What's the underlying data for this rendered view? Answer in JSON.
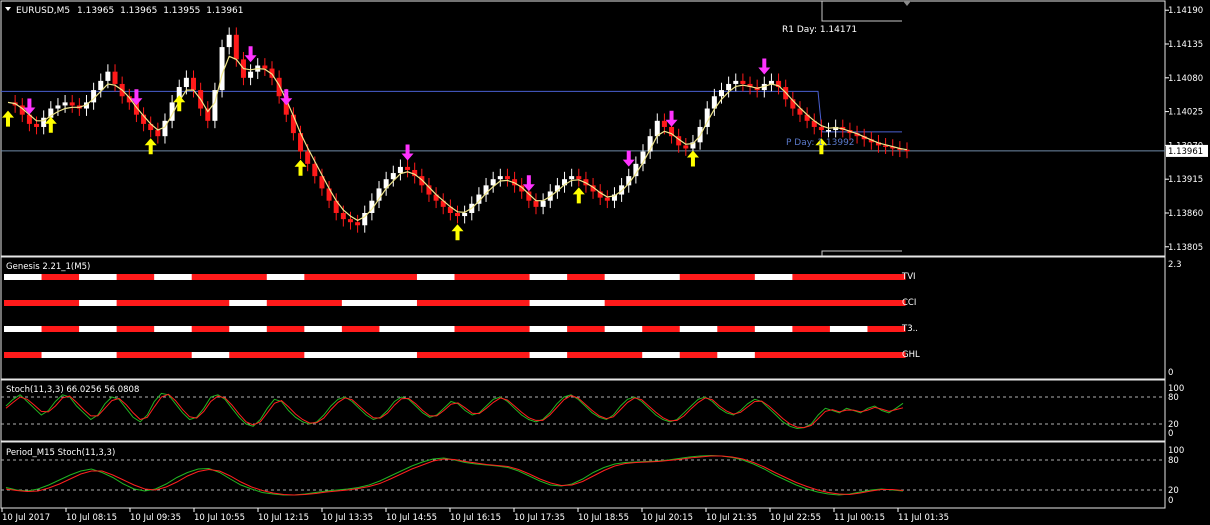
{
  "chart_data": {
    "type": "candlestick",
    "main": {
      "title": "EURUSD,M5",
      "ohlc": [
        "1.13965",
        "1.13965",
        "1.13955",
        "1.13961"
      ],
      "ylim": [
        1.1379,
        1.14205
      ],
      "y_ticks": [
        "1.14190",
        "1.14135",
        "1.14080",
        "1.14025",
        "1.13970",
        "1.13915",
        "1.13860",
        "1.13805"
      ],
      "current_price": "1.13961",
      "r1_label": "R1 Day: 1.14171",
      "pivot_label": "P Day: 1.13992",
      "pivot_level": 1.13992,
      "old_level": 1.14058,
      "close_series": [
        1.1404,
        1.14035,
        1.1402,
        1.14005,
        1.14,
        1.14015,
        1.1403,
        1.14035,
        1.1404,
        1.14035,
        1.1403,
        1.1404,
        1.1406,
        1.14075,
        1.1409,
        1.1407,
        1.1405,
        1.1404,
        1.1402,
        1.14005,
        1.13995,
        1.13985,
        1.1401,
        1.1404,
        1.14065,
        1.1408,
        1.1406,
        1.1403,
        1.1401,
        1.1406,
        1.1413,
        1.1415,
        1.1411,
        1.1408,
        1.1409,
        1.141,
        1.14095,
        1.1408,
        1.1405,
        1.1402,
        1.1399,
        1.1396,
        1.1394,
        1.1392,
        1.139,
        1.1388,
        1.1386,
        1.1385,
        1.13845,
        1.1384,
        1.1386,
        1.1388,
        1.139,
        1.13915,
        1.13925,
        1.13935,
        1.1393,
        1.1392,
        1.13905,
        1.1389,
        1.1388,
        1.1387,
        1.1386,
        1.13855,
        1.1386,
        1.13875,
        1.1389,
        1.13905,
        1.13915,
        1.1392,
        1.13915,
        1.13905,
        1.13895,
        1.1388,
        1.1387,
        1.1388,
        1.13895,
        1.13905,
        1.13915,
        1.1392,
        1.13915,
        1.13905,
        1.13895,
        1.13885,
        1.1388,
        1.1389,
        1.13905,
        1.1392,
        1.1394,
        1.1396,
        1.13985,
        1.1401,
        1.14,
        1.13985,
        1.1397,
        1.13965,
        1.13975,
        1.14,
        1.1403,
        1.1405,
        1.1406,
        1.1407,
        1.14075,
        1.1407,
        1.14065,
        1.1406,
        1.1407,
        1.14075,
        1.14065,
        1.14045,
        1.1403,
        1.1402,
        1.1401,
        1.14,
        1.13995,
        1.13995,
        1.14,
        1.13995,
        1.1399,
        1.13985,
        1.1398,
        1.13975,
        1.1397,
        1.13968,
        1.13965,
        1.13963,
        1.13961
      ],
      "ma_series": [
        1.1404,
        1.14038,
        1.1403,
        1.1402,
        1.1401,
        1.1401,
        1.14018,
        1.14025,
        1.1403,
        1.14032,
        1.14032,
        1.14036,
        1.14046,
        1.14058,
        1.1407,
        1.14068,
        1.1406,
        1.14048,
        1.14032,
        1.14018,
        1.14005,
        1.13995,
        1.14,
        1.1402,
        1.14042,
        1.1406,
        1.1406,
        1.14045,
        1.14025,
        1.1404,
        1.14085,
        1.14115,
        1.1411,
        1.14095,
        1.14093,
        1.14095,
        1.14094,
        1.14086,
        1.14068,
        1.14044,
        1.14018,
        1.1399,
        1.13966,
        1.13944,
        1.13922,
        1.139,
        1.1388,
        1.13865,
        1.13855,
        1.13848,
        1.13854,
        1.13866,
        1.13883,
        1.139,
        1.13912,
        1.13924,
        1.13927,
        1.13923,
        1.13914,
        1.13902,
        1.1389,
        1.1388,
        1.1387,
        1.13862,
        1.13861,
        1.13868,
        1.13879,
        1.13892,
        1.13903,
        1.13912,
        1.13913,
        1.13909,
        1.13902,
        1.13891,
        1.1388,
        1.1388,
        1.13887,
        1.13896,
        1.13906,
        1.13913,
        1.13914,
        1.13909,
        1.13902,
        1.13893,
        1.13886,
        1.13888,
        1.13896,
        1.13908,
        1.13924,
        1.13942,
        1.13963,
        1.13986,
        1.13993,
        1.13989,
        1.1398,
        1.13972,
        1.13973,
        1.13986,
        1.14008,
        1.14029,
        1.14045,
        1.14057,
        1.14066,
        1.14068,
        1.14066,
        1.14063,
        1.14066,
        1.1407,
        1.14067,
        1.14056,
        1.14043,
        1.14031,
        1.1402,
        1.1401,
        1.14002,
        1.13998,
        1.13999,
        1.13997,
        1.13993,
        1.13989,
        1.13984,
        1.13979,
        1.13974,
        1.13971,
        1.13968,
        1.13965,
        1.13963
      ],
      "arrows_up": [
        0,
        6,
        20,
        24,
        41,
        63,
        80,
        96,
        114
      ],
      "arrows_down": [
        3,
        18,
        34,
        39,
        56,
        73,
        87,
        93,
        106
      ]
    },
    "x_ticks": [
      "10 Jul 2017",
      "10 Jul 08:15",
      "10 Jul 09:35",
      "10 Jul 10:55",
      "10 Jul 12:15",
      "10 Jul 13:35",
      "10 Jul 14:55",
      "10 Jul 16:15",
      "10 Jul 17:35",
      "10 Jul 18:55",
      "10 Jul 20:15",
      "10 Jul 21:35",
      "10 Jul 22:55",
      "11 Jul 00:15",
      "11 Jul 01:35"
    ],
    "genesis": {
      "title": "Genesis 2.21_1(M5)",
      "y_ticks": [
        "2.3",
        "0"
      ],
      "rows": [
        {
          "name": "TVI",
          "segments": [
            "w",
            "r",
            "w",
            "r",
            "w",
            "r",
            "r",
            "w",
            "r",
            "r",
            "r",
            "w",
            "r",
            "r",
            "w",
            "r",
            "w",
            "w",
            "r",
            "r",
            "w",
            "r",
            "r",
            "r"
          ]
        },
        {
          "name": "CCI",
          "segments": [
            "r",
            "r",
            "w",
            "r",
            "r",
            "r",
            "w",
            "r",
            "r",
            "w",
            "w",
            "r",
            "r",
            "r",
            "w",
            "w",
            "r",
            "r",
            "r",
            "r",
            "r",
            "r",
            "r",
            "r"
          ]
        },
        {
          "name": "T3..",
          "segments": [
            "w",
            "r",
            "w",
            "r",
            "w",
            "r",
            "w",
            "r",
            "w",
            "r",
            "w",
            "w",
            "r",
            "r",
            "w",
            "r",
            "w",
            "r",
            "w",
            "r",
            "w",
            "r",
            "w",
            "r"
          ]
        },
        {
          "name": "GHL",
          "segments": [
            "r",
            "w",
            "w",
            "r",
            "r",
            "w",
            "r",
            "r",
            "w",
            "w",
            "w",
            "r",
            "r",
            "r",
            "w",
            "r",
            "r",
            "w",
            "r",
            "w",
            "r",
            "r",
            "r",
            "r"
          ]
        }
      ]
    },
    "stoch1": {
      "title": "Stoch(11,3,3) 66.0256 56.0808",
      "y_ticks": [
        "100",
        "80",
        "20",
        "0"
      ],
      "main": [
        60,
        75,
        85,
        70,
        55,
        40,
        50,
        70,
        85,
        80,
        60,
        45,
        30,
        40,
        65,
        80,
        75,
        55,
        35,
        25,
        40,
        70,
        88,
        85,
        65,
        45,
        30,
        35,
        55,
        80,
        85,
        75,
        55,
        35,
        20,
        15,
        30,
        55,
        75,
        70,
        50,
        35,
        25,
        20,
        25,
        40,
        60,
        75,
        80,
        70,
        55,
        40,
        30,
        35,
        50,
        70,
        80,
        75,
        60,
        45,
        35,
        40,
        55,
        70,
        65,
        50,
        40,
        45,
        60,
        75,
        80,
        70,
        55,
        40,
        30,
        25,
        30,
        45,
        65,
        80,
        85,
        75,
        60,
        45,
        35,
        30,
        40,
        60,
        75,
        80,
        70,
        55,
        40,
        30,
        25,
        30,
        45,
        60,
        75,
        80,
        70,
        55,
        45,
        40,
        50,
        65,
        75,
        70,
        55,
        40,
        25,
        15,
        10,
        12,
        20,
        40,
        55,
        50,
        45,
        55,
        50,
        45,
        55,
        60,
        50,
        45,
        55,
        66
      ],
      "signal": [
        55,
        68,
        80,
        75,
        62,
        48,
        47,
        60,
        78,
        82,
        68,
        52,
        38,
        38,
        55,
        72,
        77,
        63,
        45,
        30,
        35,
        58,
        80,
        86,
        72,
        52,
        36,
        33,
        48,
        70,
        82,
        78,
        62,
        42,
        25,
        18,
        25,
        45,
        66,
        72,
        58,
        42,
        30,
        22,
        23,
        33,
        52,
        68,
        78,
        74,
        60,
        46,
        34,
        33,
        44,
        62,
        76,
        77,
        65,
        50,
        38,
        38,
        50,
        64,
        67,
        56,
        44,
        43,
        55,
        68,
        78,
        73,
        60,
        46,
        34,
        28,
        28,
        40,
        57,
        74,
        83,
        78,
        64,
        50,
        38,
        32,
        36,
        52,
        68,
        78,
        74,
        60,
        46,
        34,
        27,
        28,
        38,
        54,
        68,
        78,
        74,
        60,
        49,
        42,
        46,
        58,
        70,
        71,
        60,
        46,
        32,
        20,
        13,
        12,
        17,
        32,
        48,
        52,
        47,
        51,
        51,
        47,
        51,
        57,
        53,
        48,
        52,
        56
      ]
    },
    "stoch2": {
      "title": "Period_M15 Stoch(11,3,3)",
      "y_ticks": [
        "100",
        "80",
        "20",
        "0"
      ],
      "main": [
        25,
        20,
        18,
        22,
        30,
        40,
        50,
        58,
        62,
        55,
        45,
        32,
        22,
        18,
        22,
        32,
        45,
        55,
        62,
        63,
        55,
        42,
        30,
        22,
        15,
        12,
        10,
        10,
        12,
        15,
        18,
        20,
        22,
        25,
        30,
        38,
        48,
        58,
        68,
        76,
        82,
        84,
        80,
        75,
        72,
        70,
        68,
        65,
        58,
        48,
        38,
        30,
        28,
        32,
        42,
        55,
        65,
        72,
        75,
        76,
        77,
        78,
        80,
        83,
        86,
        88,
        89,
        88,
        85,
        80,
        72,
        62,
        50,
        40,
        30,
        22,
        16,
        12,
        10,
        12,
        16,
        20,
        22,
        20,
        18
      ],
      "signal": [
        22,
        19,
        17,
        18,
        24,
        32,
        42,
        52,
        58,
        58,
        50,
        40,
        30,
        22,
        20,
        26,
        36,
        48,
        57,
        61,
        58,
        48,
        36,
        26,
        19,
        14,
        11,
        10,
        11,
        13,
        16,
        18,
        20,
        23,
        27,
        33,
        42,
        52,
        62,
        70,
        78,
        82,
        81,
        77,
        74,
        71,
        69,
        67,
        61,
        52,
        42,
        34,
        29,
        30,
        37,
        48,
        59,
        68,
        73,
        75,
        76,
        77,
        79,
        81,
        84,
        86,
        88,
        88,
        86,
        82,
        75,
        66,
        55,
        45,
        35,
        27,
        20,
        15,
        12,
        11,
        14,
        18,
        21,
        21,
        19
      ]
    }
  }
}
